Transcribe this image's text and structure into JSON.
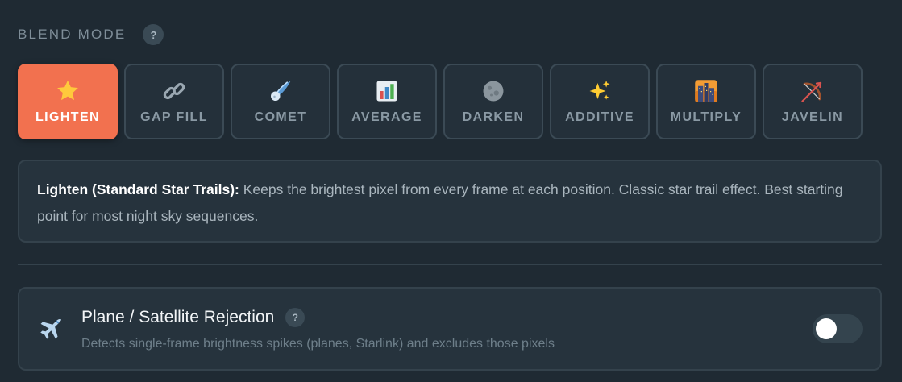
{
  "section": {
    "title": "BLEND MODE",
    "help": "?"
  },
  "modes": [
    {
      "label": "LIGHTEN",
      "icon": "star-icon",
      "active": true
    },
    {
      "label": "GAP FILL",
      "icon": "link-icon",
      "active": false
    },
    {
      "label": "COMET",
      "icon": "comet-icon",
      "active": false
    },
    {
      "label": "AVERAGE",
      "icon": "bar-chart-icon",
      "active": false
    },
    {
      "label": "DARKEN",
      "icon": "moon-icon",
      "active": false
    },
    {
      "label": "ADDITIVE",
      "icon": "sparkles-icon",
      "active": false
    },
    {
      "label": "MULTIPLY",
      "icon": "city-night-icon",
      "active": false
    },
    {
      "label": "JAVELIN",
      "icon": "bow-arrow-icon",
      "active": false
    }
  ],
  "description": {
    "title": "Lighten (Standard Star Trails):",
    "text": " Keeps the brightest pixel from every frame at each position. Classic star trail effect. Best starting point for most night sky sequences."
  },
  "plane_rejection": {
    "icon": "airplane-icon",
    "title": "Plane / Satellite Rejection",
    "help": "?",
    "description": "Detects single-frame brightness spikes (planes, Starlink) and excludes those pixels",
    "enabled": false
  },
  "colors": {
    "accent": "#f2714f",
    "background": "#1f2a33",
    "card": "#26333d"
  }
}
